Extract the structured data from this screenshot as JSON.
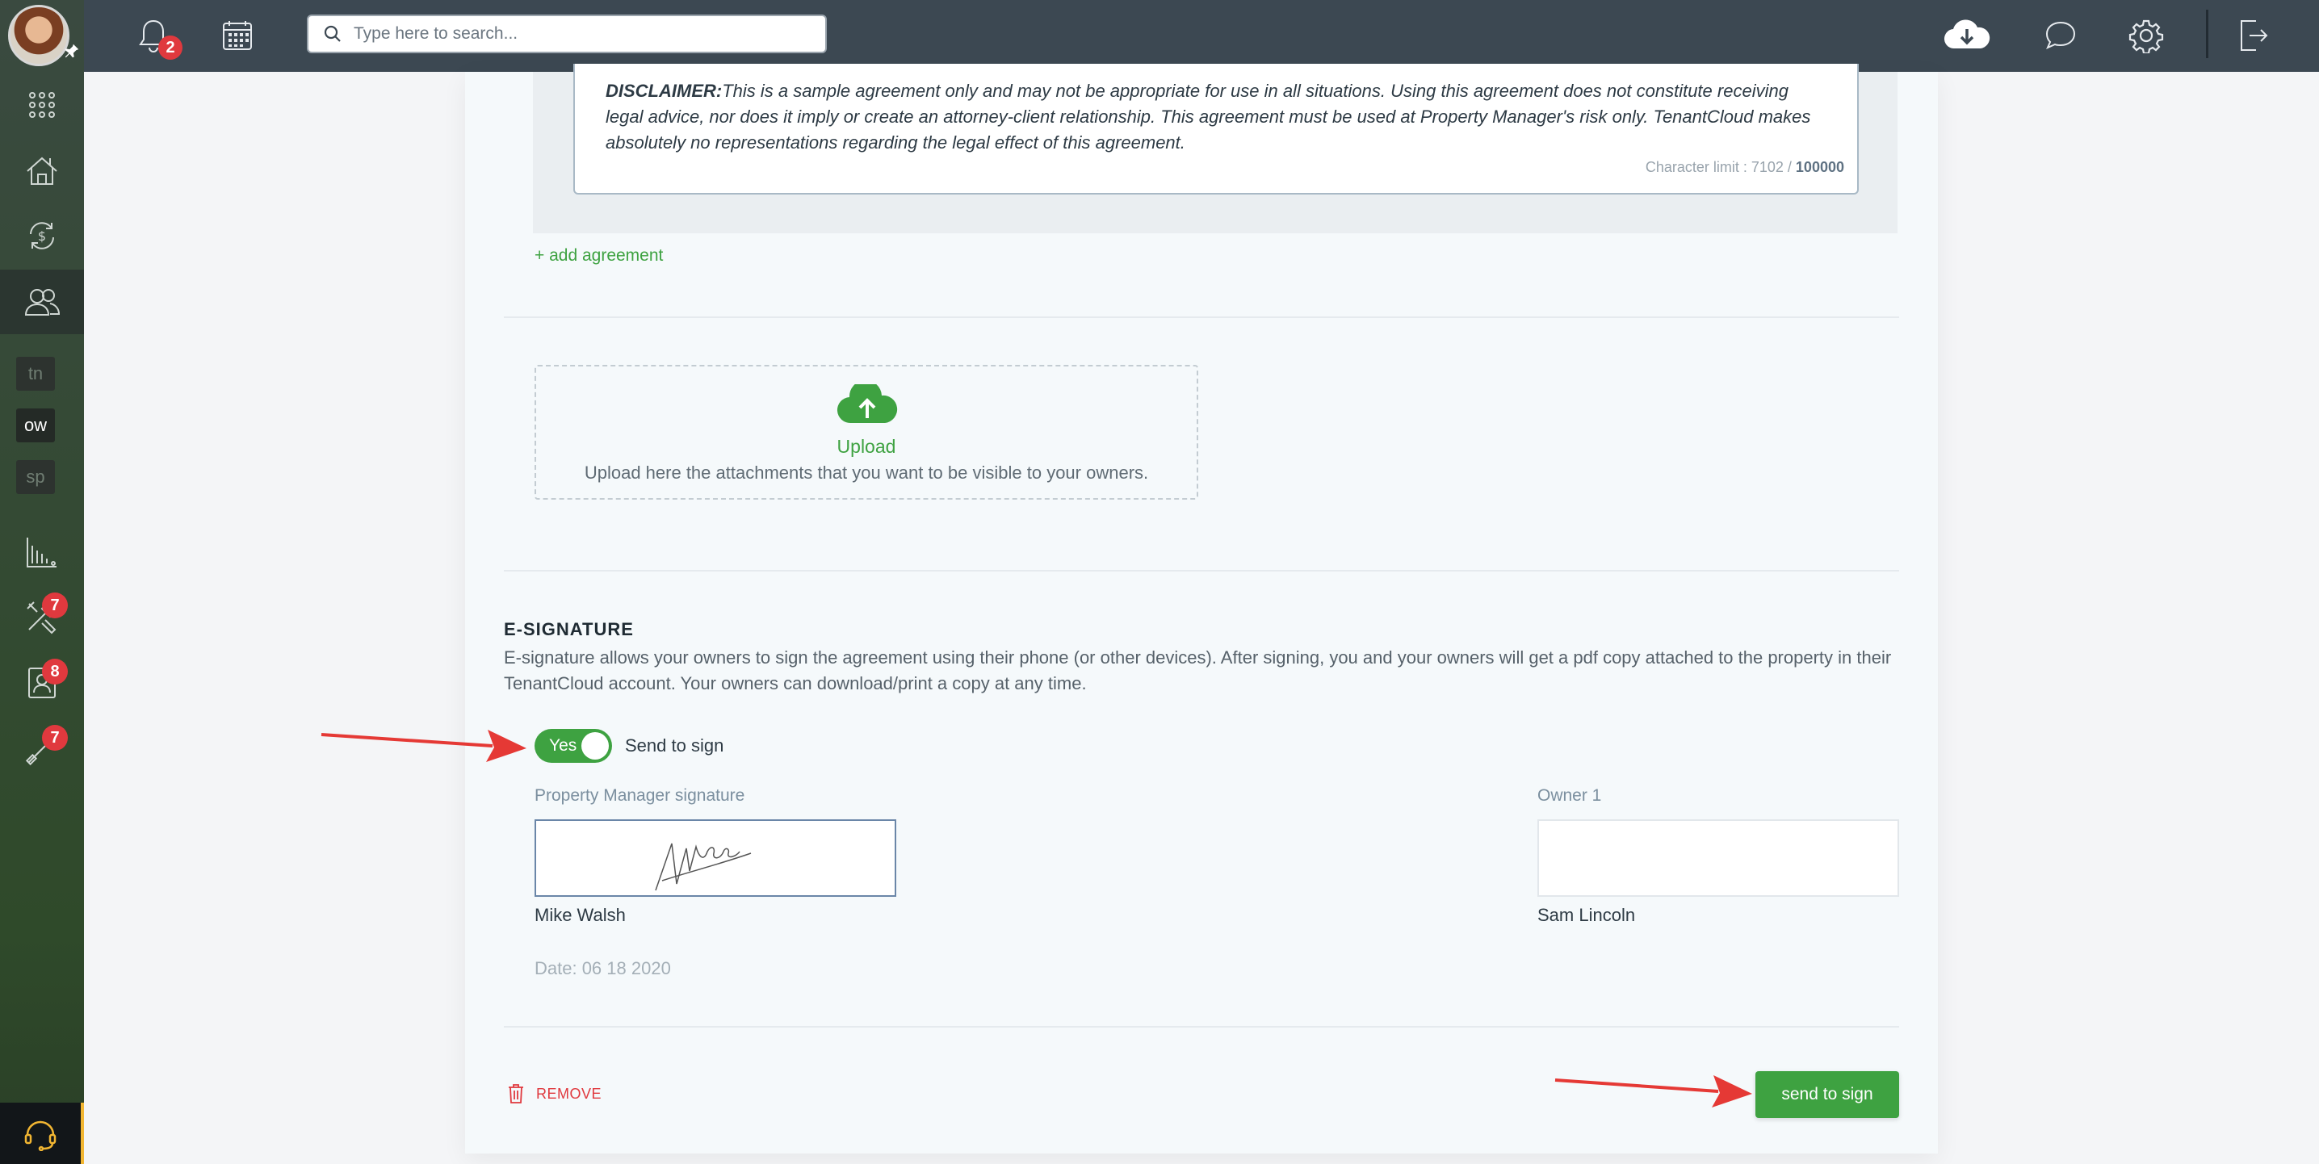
{
  "topbar": {
    "notifications_count": "2",
    "search_placeholder": "Type here to search..."
  },
  "sidebar": {
    "roles": [
      "tn",
      "ow",
      "sp"
    ],
    "badges": {
      "maintenance": "7",
      "applications": "8",
      "services": "7"
    }
  },
  "agreement": {
    "disclaimer_label": "DISCLAIMER:",
    "disclaimer_text": "This is a sample agreement only and may not be appropriate for use in all situations. Using this agreement does not constitute receiving legal advice, nor does it imply or create an attorney-client relationship. This agreement must be used at Property Manager's risk only. TenantCloud makes absolutely no representations regarding the legal effect of this agreement.",
    "char_limit_label": "Character limit : 7102 /",
    "char_limit_max": "100000",
    "add_agreement_label": "+ add agreement"
  },
  "upload": {
    "title": "Upload",
    "description": "Upload here the attachments that you want to be visible to your owners."
  },
  "esignature": {
    "title": "E-SIGNATURE",
    "description": "E-signature allows your owners to sign the agreement using their phone (or other devices). After signing, you and your owners will get a pdf copy attached to the property in their TenantCloud account. Your owners can download/print a copy at any time.",
    "toggle_label": "Yes",
    "toggle_on": true,
    "send_to_sign_label": "Send to sign",
    "pm_signature_label": "Property Manager signature",
    "pm_name": "Mike Walsh",
    "owner_label": "Owner 1",
    "owner_name": "Sam Lincoln",
    "date": "Date: 06 18 2020"
  },
  "actions": {
    "remove_label": "REMOVE",
    "send_button_label": "send to sign"
  },
  "colors": {
    "accent_green": "#3ea241",
    "danger_red": "#e0393e",
    "annotation_red": "#e53935"
  }
}
